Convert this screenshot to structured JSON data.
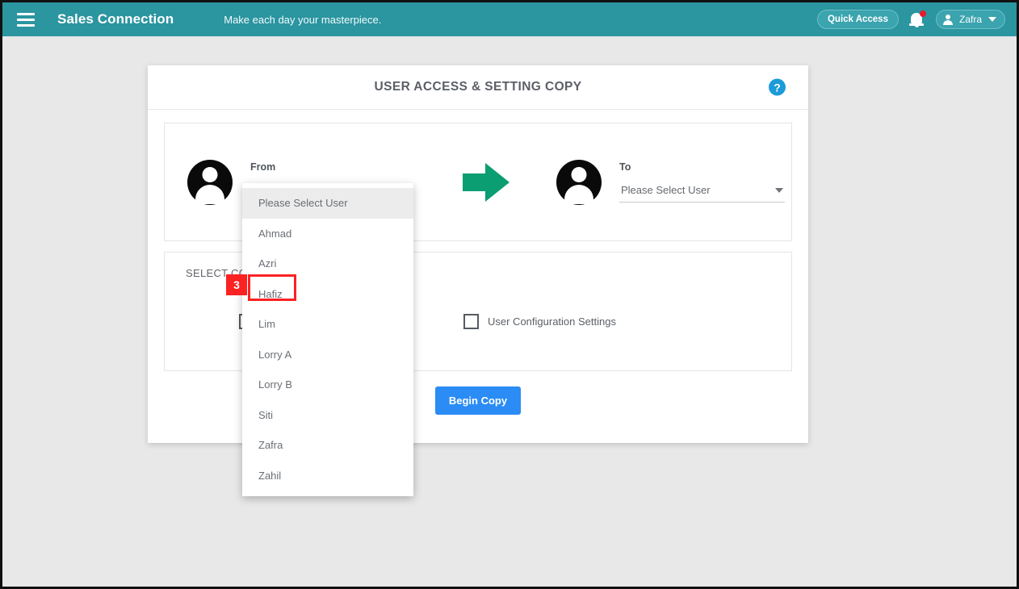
{
  "appbar": {
    "menu_icon": "hamburger-menu-icon",
    "brand": "Sales Connection",
    "tagline": "Make each day your masterpiece.",
    "quick_access_label": "Quick Access",
    "notification_icon": "bell-icon",
    "notification_badge": "",
    "user_name": "Zafra",
    "user_caret": "chevron-down-icon",
    "background_color": "#2b95a0"
  },
  "card": {
    "title": "USER ACCESS & SETTING COPY",
    "help_icon_glyph": "?",
    "help_icon_color": "#1b9bd8"
  },
  "transfer": {
    "from": {
      "label": "From",
      "avatar_icon": "user-avatar-icon",
      "value": "",
      "placeholder": "Please Select User"
    },
    "arrow_icon": "arrow-right-icon",
    "arrow_color": "#0a9e72",
    "to": {
      "label": "To",
      "avatar_icon": "user-avatar-icon",
      "value": "Please Select User",
      "caret_icon": "chevron-down-icon"
    }
  },
  "dropdown": {
    "open": true,
    "selected_index": 0,
    "items": [
      "Please Select User",
      "Ahmad",
      "Azri",
      "Hafiz",
      "Lim",
      "Lorry A",
      "Lorry B",
      "Siti",
      "Zafra",
      "Zahil"
    ]
  },
  "copy_options": {
    "title": "SELECT COPY OPTION",
    "items": [
      {
        "label": "",
        "checked": false
      },
      {
        "label": "User Configuration Settings",
        "checked": false
      }
    ]
  },
  "footer": {
    "begin_copy_label": "Begin Copy",
    "begin_copy_color": "#2a8cf4"
  },
  "annotation": {
    "step_number": "3",
    "target": "Hafiz",
    "color": "#fb2222"
  }
}
